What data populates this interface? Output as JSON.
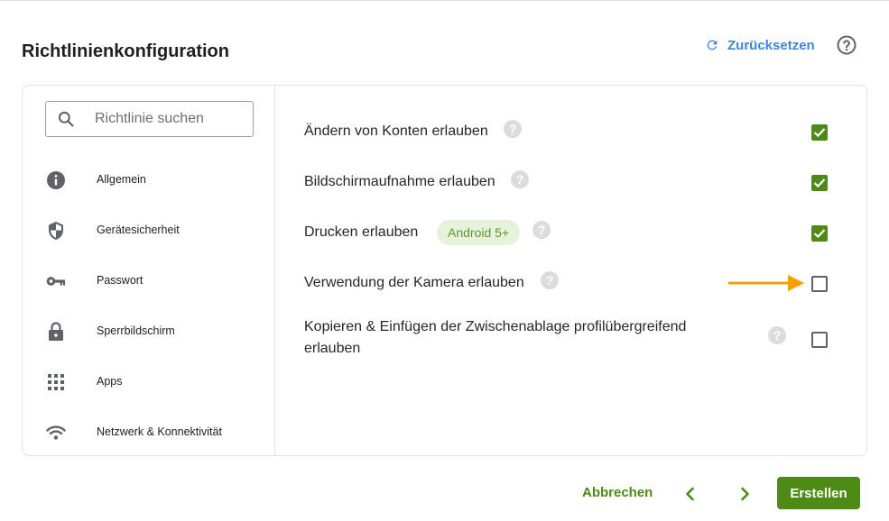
{
  "header": {
    "title": "Richtlinienkonfiguration",
    "reset_label": "Zurücksetzen",
    "reset_icon": "refresh-icon",
    "help_icon": "help-circle-icon"
  },
  "sidebar": {
    "search": {
      "placeholder": "Richtlinie suchen",
      "value": ""
    },
    "items": [
      {
        "label": "Allgemein",
        "icon": "info-icon"
      },
      {
        "label": "Gerätesicherheit",
        "icon": "shield-icon"
      },
      {
        "label": "Passwort",
        "icon": "key-icon"
      },
      {
        "label": "Sperrbildschirm",
        "icon": "lock-icon"
      },
      {
        "label": "Apps",
        "icon": "apps-grid-icon"
      },
      {
        "label": "Netzwerk & Konnektivität",
        "icon": "wifi-icon"
      }
    ]
  },
  "settings": [
    {
      "label": "Ändern von Konten erlauben",
      "checked": true
    },
    {
      "label": "Bildschirmaufnahme erlauben",
      "checked": true
    },
    {
      "label": "Drucken erlauben",
      "badge": "Android 5+",
      "checked": true
    },
    {
      "label": "Verwendung der Kamera erlauben",
      "checked": false
    },
    {
      "label_line1": "Kopieren & Einfügen der Zwischenablage profilübergreifend",
      "label_line2": "erlauben",
      "checked": false
    }
  ],
  "help_mark": "?",
  "footer": {
    "cancel_label": "Abbrechen",
    "create_label": "Erstellen"
  },
  "colors": {
    "accent_green": "#4e8b16",
    "link_blue": "#3c87d9",
    "annotation_arrow": "#f5a000",
    "badge_bg": "#e6f3da"
  }
}
